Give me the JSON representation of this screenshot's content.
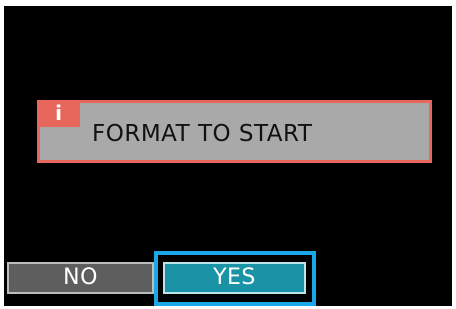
{
  "dialog": {
    "icon": "info-icon",
    "icon_glyph": "i",
    "message": "FORMAT TO START"
  },
  "buttons": {
    "no_label": "NO",
    "yes_label": "YES",
    "selected": "YES"
  },
  "colors": {
    "screen_background": "#000000",
    "dialog_border": "#e8675c",
    "dialog_fill": "#a9a9a9",
    "no_button": "#5e5e5e",
    "yes_button": "#1b93a6",
    "selection_frame": "#1aa8e8"
  }
}
